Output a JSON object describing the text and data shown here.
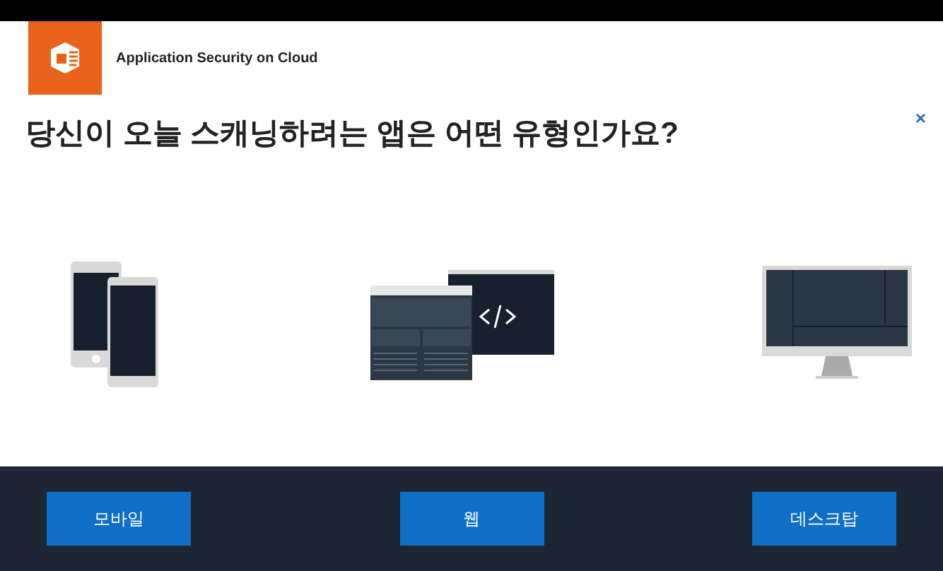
{
  "header": {
    "brand": "Application Security on Cloud"
  },
  "close": "×",
  "question": "당신이 오늘 스캐닝하려는 앱은 어떤 유형인가요?",
  "options": [
    {
      "kind": "mobile",
      "label": "모바일"
    },
    {
      "kind": "web",
      "label": "웹"
    },
    {
      "kind": "desktop",
      "label": "데스크탑"
    }
  ]
}
